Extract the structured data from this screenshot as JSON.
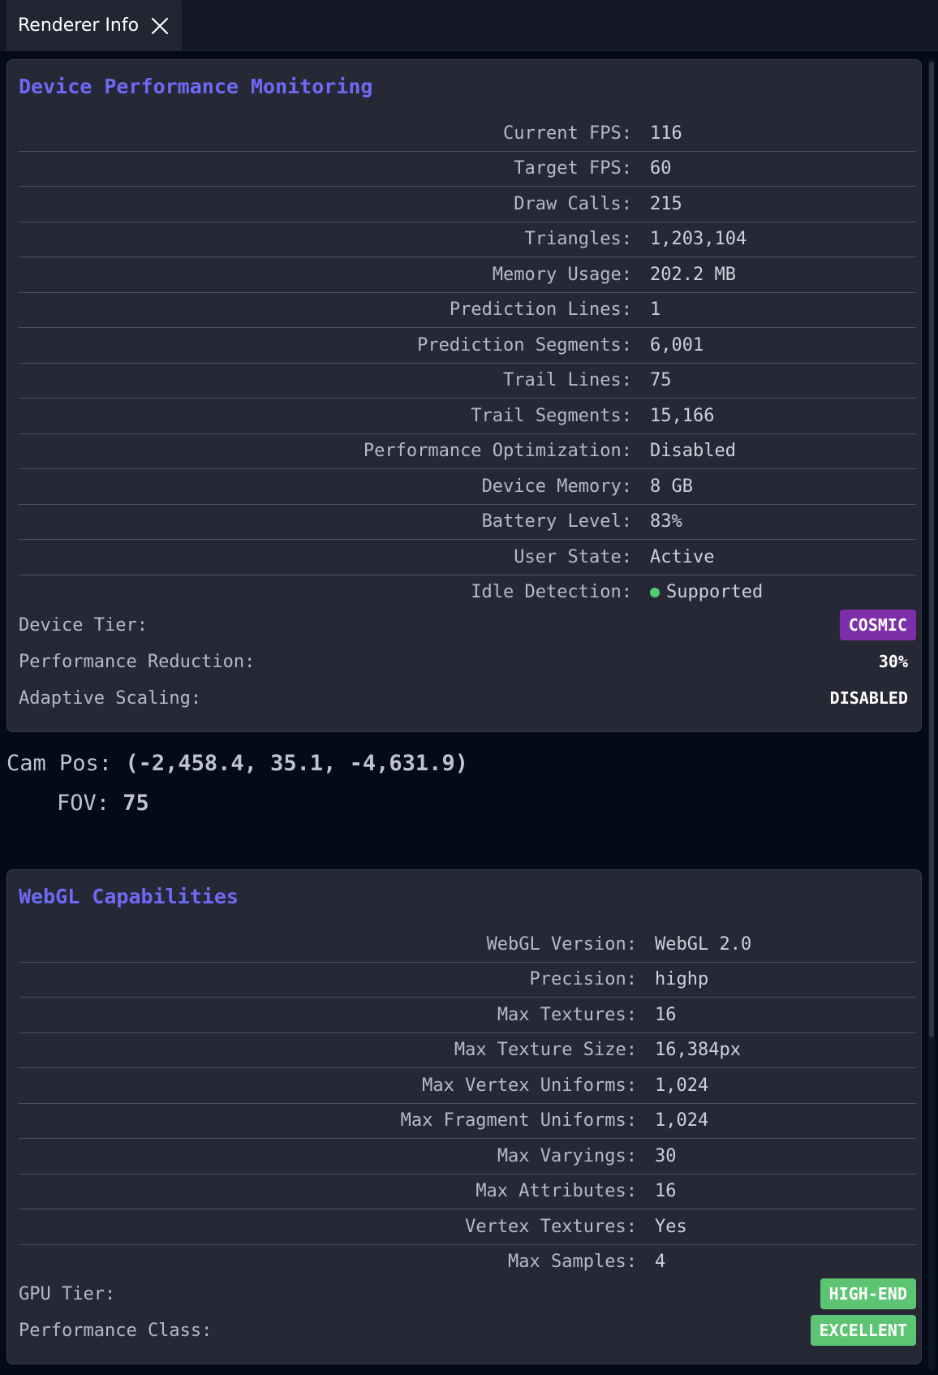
{
  "tab": {
    "label": "Renderer Info",
    "close_icon": "close-icon"
  },
  "performance": {
    "title": "Device Performance Monitoring",
    "rows": [
      {
        "key": "Current FPS:",
        "value": "116"
      },
      {
        "key": "Target FPS:",
        "value": "60"
      },
      {
        "key": "Draw Calls:",
        "value": "215"
      },
      {
        "key": "Triangles:",
        "value": "1,203,104"
      },
      {
        "key": "Memory Usage:",
        "value": "202.2 MB"
      },
      {
        "key": "Prediction Lines:",
        "value": "1"
      },
      {
        "key": "Prediction Segments:",
        "value": "6,001"
      },
      {
        "key": "Trail Lines:",
        "value": "75"
      },
      {
        "key": "Trail Segments:",
        "value": "15,166"
      },
      {
        "key": "Performance Optimization:",
        "value": "Disabled"
      },
      {
        "key": "Device Memory:",
        "value": "8 GB"
      },
      {
        "key": "Battery Level:",
        "value": "83%"
      },
      {
        "key": "User State:",
        "value": "Active"
      },
      {
        "key": "Idle Detection:",
        "value": "Supported",
        "status_color": "#4fcf70"
      }
    ],
    "device_tier": {
      "label": "Device Tier:",
      "value": "COSMIC",
      "color": "#7e2ea8"
    },
    "performance_reduction": {
      "label": "Performance Reduction:",
      "value": "30%"
    },
    "adaptive_scaling": {
      "label": "Adaptive Scaling:",
      "value": "DISABLED"
    }
  },
  "camera": {
    "pos_label": "Cam Pos:",
    "pos_value": "(-2,458.4, 35.1, -4,631.9)",
    "fov_label": "FOV:",
    "fov_value": "75"
  },
  "webgl": {
    "title": "WebGL Capabilities",
    "rows": [
      {
        "key": "WebGL Version:",
        "value": "WebGL 2.0"
      },
      {
        "key": "Precision:",
        "value": "highp"
      },
      {
        "key": "Max Textures:",
        "value": "16"
      },
      {
        "key": "Max Texture Size:",
        "value": "16,384px"
      },
      {
        "key": "Max Vertex Uniforms:",
        "value": "1,024"
      },
      {
        "key": "Max Fragment Uniforms:",
        "value": "1,024"
      },
      {
        "key": "Max Varyings:",
        "value": "30"
      },
      {
        "key": "Max Attributes:",
        "value": "16"
      },
      {
        "key": "Vertex Textures:",
        "value": "Yes"
      },
      {
        "key": "Max Samples:",
        "value": "4"
      }
    ],
    "gpu_tier": {
      "label": "GPU Tier:",
      "value": "HIGH-END",
      "color": "#5cc472"
    },
    "performance_class": {
      "label": "Performance Class:",
      "value": "EXCELLENT",
      "color": "#5cc472"
    }
  },
  "colors": {
    "accent": "#6d6af6",
    "background": "#030b16",
    "panel": "#272835"
  }
}
